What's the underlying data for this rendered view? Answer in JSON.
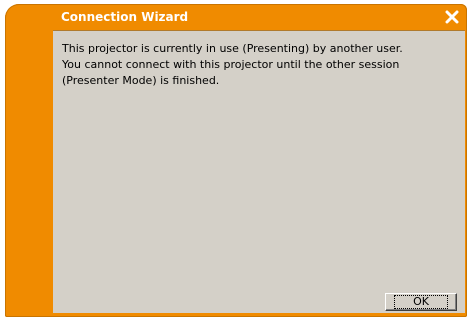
{
  "window": {
    "title": "Connection Wizard",
    "close_icon": "close-x-icon",
    "accent_color": "#f08b00",
    "content_bg": "#d4d0c8"
  },
  "message": {
    "line1": "This projector is currently in use (Presenting) by another user.",
    "line2": "You cannot connect with this projector until the other session (Presenter Mode) is finished."
  },
  "buttons": {
    "ok_label": "OK"
  }
}
